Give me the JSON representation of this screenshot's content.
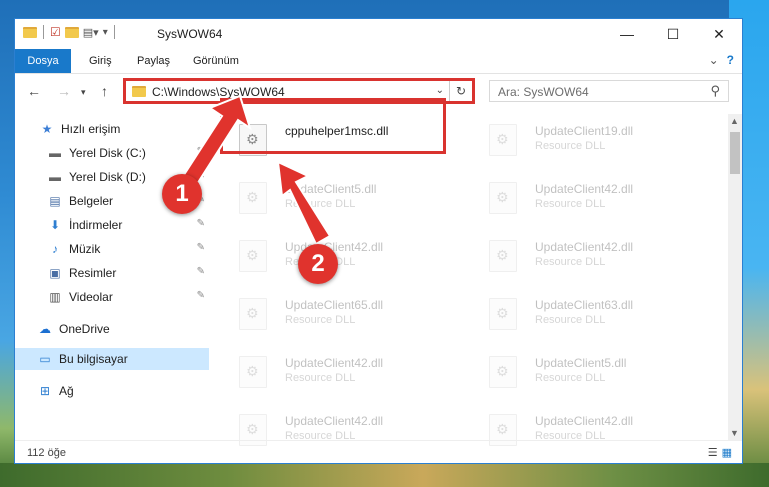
{
  "window": {
    "title": "SysWOW64",
    "controls": {
      "minimize": "—",
      "maximize": "☐",
      "close": "✕"
    }
  },
  "ribbon": {
    "tabs": [
      "Dosya",
      "Giriş",
      "Paylaş",
      "Görünüm"
    ],
    "expand_glyph": "⌄",
    "help_glyph": "?"
  },
  "address": {
    "path": "C:\\Windows\\SysWOW64",
    "search_placeholder": "Ara: SysWOW64"
  },
  "sidebar": {
    "items": [
      {
        "label": "Hızlı erişim",
        "icon": "star-icon",
        "glyph": "★"
      },
      {
        "label": "Yerel Disk (C:)",
        "icon": "drive-icon",
        "glyph": "▬",
        "pinned": true
      },
      {
        "label": "Yerel Disk (D:)",
        "icon": "drive-icon",
        "glyph": "▬",
        "pinned": true
      },
      {
        "label": "Belgeler",
        "icon": "document-icon",
        "glyph": "▤",
        "pinned": true
      },
      {
        "label": "İndirmeler",
        "icon": "download-icon",
        "glyph": "⬇",
        "pinned": true
      },
      {
        "label": "Müzik",
        "icon": "music-icon",
        "glyph": "♪",
        "pinned": true
      },
      {
        "label": "Resimler",
        "icon": "picture-icon",
        "glyph": "▣",
        "pinned": true
      },
      {
        "label": "Videolar",
        "icon": "video-icon",
        "glyph": "▥",
        "pinned": true
      },
      {
        "label": "OneDrive",
        "icon": "cloud-icon",
        "glyph": "☁"
      },
      {
        "label": "Bu bilgisayar",
        "icon": "computer-icon",
        "glyph": "▭",
        "selected": true
      },
      {
        "label": "Ağ",
        "icon": "network-icon",
        "glyph": "⊞"
      }
    ],
    "pin_glyph": "📌"
  },
  "files": {
    "highlighted": {
      "name": "cppuhelper1msc.dll"
    },
    "left_column": [
      {
        "name": "UpdateClient5.dll",
        "type": "Resource DLL"
      },
      {
        "name": "UpdateClient42.dll",
        "type": "Resource DLL"
      },
      {
        "name": "UpdateClient65.dll",
        "type": "Resource DLL"
      },
      {
        "name": "UpdateClient42.dll",
        "type": "Resource DLL"
      },
      {
        "name": "UpdateClient42.dll",
        "type": "Resource DLL"
      }
    ],
    "right_column": [
      {
        "name": "UpdateClient19.dll",
        "type": "Resource DLL"
      },
      {
        "name": "UpdateClient42.dll",
        "type": "Resource DLL"
      },
      {
        "name": "UpdateClient42.dll",
        "type": "Resource DLL"
      },
      {
        "name": "UpdateClient63.dll",
        "type": "Resource DLL"
      },
      {
        "name": "UpdateClient5.dll",
        "type": "Resource DLL"
      },
      {
        "name": "UpdateClient42.dll",
        "type": "Resource DLL"
      }
    ]
  },
  "status": {
    "item_count": "112 öğe"
  },
  "callouts": {
    "one": "1",
    "two": "2"
  },
  "colors": {
    "accent": "#1979ca",
    "highlight": "#d9332f",
    "selection": "#cce8ff"
  }
}
